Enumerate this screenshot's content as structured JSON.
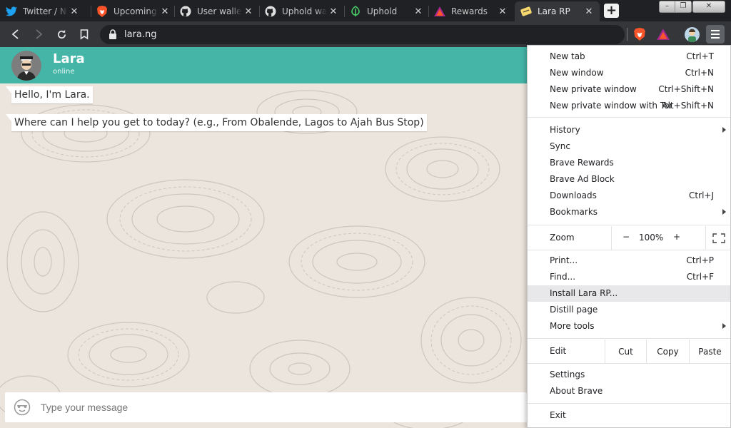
{
  "browser": {
    "tabs": [
      {
        "title": "Twitter / No",
        "icon": "twitter-icon",
        "active": false
      },
      {
        "title": "Upcoming S",
        "icon": "brave-icon",
        "active": false
      },
      {
        "title": "User wallet",
        "icon": "github-icon",
        "active": false
      },
      {
        "title": "Uphold wall",
        "icon": "github-icon",
        "active": false
      },
      {
        "title": "Uphold",
        "icon": "uphold-icon",
        "active": false
      },
      {
        "title": "Rewards",
        "icon": "rewards-icon",
        "active": false
      },
      {
        "title": "Lara RP",
        "icon": "lara-icon",
        "active": true
      }
    ],
    "tab_close": "✕",
    "new_tab": "+",
    "address": "lara.ng",
    "colors": {
      "tab_strip": "#202124",
      "toolbar": "#35363a",
      "brave_orange": "#fb542b"
    }
  },
  "chat": {
    "name": "Lara",
    "status": "online",
    "header_color": "#45b5a8",
    "messages": [
      {
        "text": "Hello, I'm Lara."
      },
      {
        "text": "Where can I help you get to today? (e.g., From Obalende, Lagos to Ajah Bus Stop)"
      }
    ],
    "input_placeholder": "Type your message"
  },
  "menu": {
    "new_tab": {
      "label": "New tab",
      "shortcut": "Ctrl+T"
    },
    "new_window": {
      "label": "New window",
      "shortcut": "Ctrl+N"
    },
    "new_private": {
      "label": "New private window",
      "shortcut": "Ctrl+Shift+N"
    },
    "new_private_tor": {
      "label": "New private window with Tor",
      "shortcut": "Alt+Shift+N"
    },
    "history": {
      "label": "History"
    },
    "sync": {
      "label": "Sync"
    },
    "brave_rewards": {
      "label": "Brave Rewards"
    },
    "brave_ad_block": {
      "label": "Brave Ad Block"
    },
    "downloads": {
      "label": "Downloads",
      "shortcut": "Ctrl+J"
    },
    "bookmarks": {
      "label": "Bookmarks"
    },
    "zoom": {
      "label": "Zoom",
      "minus": "−",
      "value": "100%",
      "plus": "+"
    },
    "print": {
      "label": "Print...",
      "shortcut": "Ctrl+P"
    },
    "find": {
      "label": "Find...",
      "shortcut": "Ctrl+F"
    },
    "install": {
      "label": "Install Lara RP..."
    },
    "distill": {
      "label": "Distill page"
    },
    "more_tools": {
      "label": "More tools"
    },
    "edit": {
      "label": "Edit",
      "cut": "Cut",
      "copy": "Copy",
      "paste": "Paste"
    },
    "settings": {
      "label": "Settings"
    },
    "about": {
      "label": "About Brave"
    },
    "exit": {
      "label": "Exit"
    }
  }
}
